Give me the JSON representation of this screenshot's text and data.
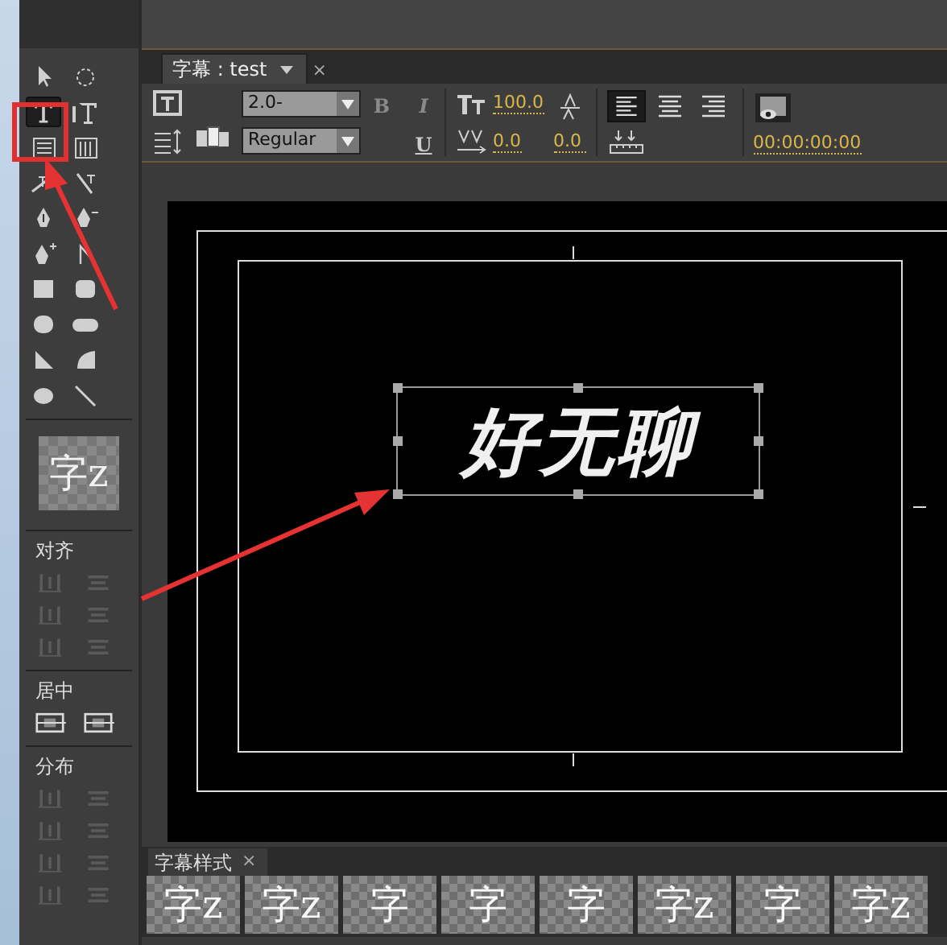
{
  "tools": [
    {
      "kind": "select",
      "selected": false
    },
    {
      "kind": "rotate",
      "selected": false
    },
    {
      "kind": "type",
      "selected": true
    },
    {
      "kind": "vertical-type",
      "selected": false
    },
    {
      "kind": "area-type",
      "selected": false
    },
    {
      "kind": "vertical-area-type",
      "selected": false
    },
    {
      "kind": "path-type",
      "selected": false
    },
    {
      "kind": "vertical-path-type",
      "selected": false
    },
    {
      "kind": "pen",
      "selected": false
    },
    {
      "kind": "delete-anchor",
      "selected": false
    },
    {
      "kind": "add-anchor",
      "selected": false
    },
    {
      "kind": "convert-anchor",
      "selected": false
    },
    {
      "kind": "rectangle",
      "selected": false
    },
    {
      "kind": "rounded-rectangle",
      "selected": false
    },
    {
      "kind": "clipped-rectangle",
      "selected": false
    },
    {
      "kind": "pill",
      "selected": false
    },
    {
      "kind": "wedge",
      "selected": false
    },
    {
      "kind": "arc",
      "selected": false
    },
    {
      "kind": "ellipse",
      "selected": false
    },
    {
      "kind": "line",
      "selected": false
    }
  ],
  "tool_preview": "字z",
  "sections": [
    {
      "label": "对齐",
      "buttons": [
        {
          "disabled": true
        },
        {
          "disabled": true
        },
        {
          "disabled": true
        },
        {
          "disabled": true
        },
        {
          "disabled": true
        },
        {
          "disabled": true
        }
      ]
    },
    {
      "label": "居中",
      "buttons": [
        {
          "disabled": false
        },
        {
          "disabled": false
        }
      ]
    },
    {
      "label": "分布",
      "buttons": [
        {
          "disabled": true
        },
        {
          "disabled": true
        },
        {
          "disabled": true
        },
        {
          "disabled": true
        },
        {
          "disabled": true
        },
        {
          "disabled": true
        },
        {
          "disabled": true
        },
        {
          "disabled": true
        }
      ]
    }
  ],
  "title_tab": {
    "label": "字幕 : test",
    "close": "×"
  },
  "toolbar": {
    "font": "2.0-",
    "style": "Regular",
    "format_buttons": [
      {
        "label": "B",
        "disabled": true
      },
      {
        "label": "I",
        "disabled": true
      },
      {
        "label": "U",
        "disabled": false
      }
    ],
    "font_size": "100.0",
    "kerning": "0.0",
    "tracking": "0.0",
    "align": [
      {
        "kind": "left",
        "selected": true
      },
      {
        "kind": "center",
        "selected": false
      },
      {
        "kind": "right",
        "selected": false
      }
    ],
    "timecode": "00:00:00:00"
  },
  "canvas": {
    "title_text": "好无聊",
    "selected": true
  },
  "styles_panel": {
    "label": "字幕样式",
    "close": "×",
    "styles": [
      "字z",
      "字z",
      "字",
      "字",
      "字",
      "字z",
      "字",
      "字z"
    ]
  }
}
